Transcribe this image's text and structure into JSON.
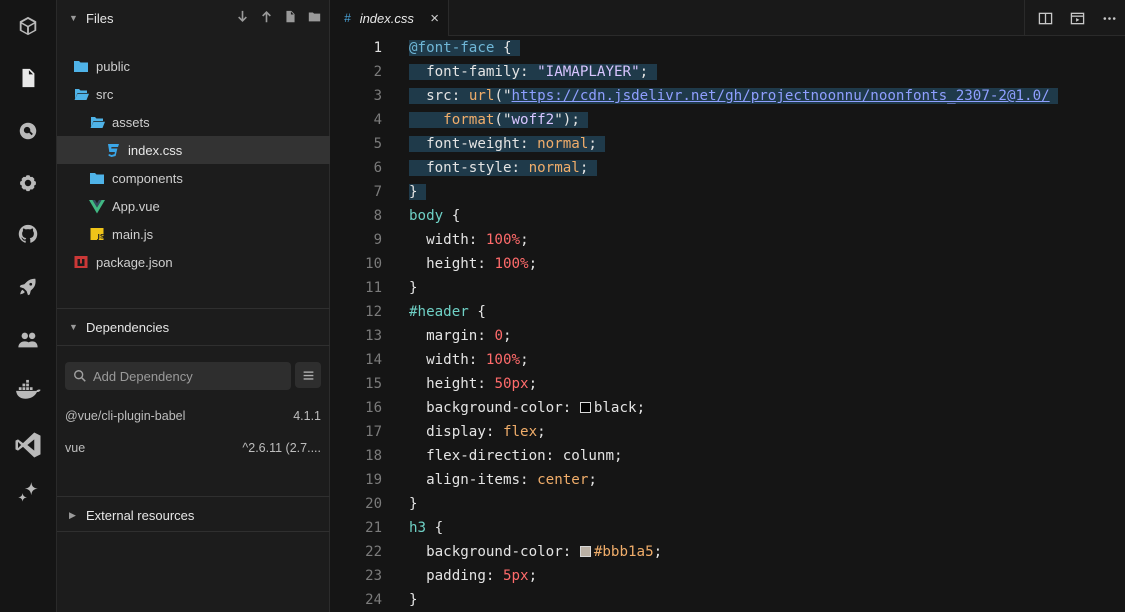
{
  "activity_bar": {
    "icons": [
      "cube-icon",
      "file-icon",
      "search-icon",
      "gear-icon",
      "github-icon",
      "rocket-icon",
      "users-icon",
      "docker-icon",
      "vscode-icon",
      "sparkle-icon"
    ]
  },
  "sidebar": {
    "files_title": "Files",
    "tree": [
      {
        "label": "public",
        "type": "folder"
      },
      {
        "label": "src",
        "type": "folder-open"
      },
      {
        "label": "assets",
        "type": "folder-open"
      },
      {
        "label": "index.css",
        "type": "css"
      },
      {
        "label": "components",
        "type": "folder"
      },
      {
        "label": "App.vue",
        "type": "vue"
      },
      {
        "label": "main.js",
        "type": "js"
      },
      {
        "label": "package.json",
        "type": "npm"
      }
    ],
    "dependencies_title": "Dependencies",
    "dep_search_placeholder": "Add Dependency",
    "dependencies": [
      {
        "name": "@vue/cli-plugin-babel",
        "version": "4.1.1"
      },
      {
        "name": "vue",
        "version": "^2.6.11 (2.7...."
      }
    ],
    "external_title": "External resources"
  },
  "editor": {
    "tab_label": "index.css",
    "tab_close": "×",
    "active_line": 1,
    "lines": [
      {
        "n": "1",
        "segs": [
          [
            "@font-face",
            "t-at"
          ],
          [
            " {",
            "t-punc"
          ]
        ],
        "hl": true
      },
      {
        "n": "2",
        "segs": [
          [
            "  font-family",
            "t-prop"
          ],
          [
            ": ",
            "t-punc"
          ],
          [
            "\"IAMAPLAYER\"",
            "t-str"
          ],
          [
            ";",
            "t-punc"
          ]
        ],
        "hl": true
      },
      {
        "n": "3",
        "segs": [
          [
            "  src",
            "t-prop"
          ],
          [
            ": ",
            "t-punc"
          ],
          [
            "url",
            "t-kw"
          ],
          [
            "(\"",
            "t-punc"
          ],
          [
            "https://cdn.jsdelivr.net/gh/projectnoonnu/noonfonts_2307-2@1.0/",
            "t-url"
          ]
        ],
        "hl": true
      },
      {
        "n": "4",
        "segs": [
          [
            "    format",
            "t-kw"
          ],
          [
            "(\"",
            "t-punc"
          ],
          [
            "woff2",
            "t-str"
          ],
          [
            "\");",
            "t-punc"
          ]
        ],
        "hl": true
      },
      {
        "n": "5",
        "segs": [
          [
            "  font-weight",
            "t-prop"
          ],
          [
            ": ",
            "t-punc"
          ],
          [
            "normal",
            "t-kw"
          ],
          [
            ";",
            "t-punc"
          ]
        ],
        "hl": true
      },
      {
        "n": "6",
        "segs": [
          [
            "  font-style",
            "t-prop"
          ],
          [
            ": ",
            "t-punc"
          ],
          [
            "normal",
            "t-kw"
          ],
          [
            ";",
            "t-punc"
          ]
        ],
        "hl": true
      },
      {
        "n": "7",
        "segs": [
          [
            "}",
            "t-punc"
          ]
        ],
        "hl": true
      },
      {
        "n": "8",
        "segs": [
          [
            "body",
            "t-sel"
          ],
          [
            " {",
            "t-punc"
          ]
        ]
      },
      {
        "n": "9",
        "segs": [
          [
            "  width",
            "t-prop"
          ],
          [
            ": ",
            "t-punc"
          ],
          [
            "100%",
            "t-num"
          ],
          [
            ";",
            "t-punc"
          ]
        ]
      },
      {
        "n": "10",
        "segs": [
          [
            "  height",
            "t-prop"
          ],
          [
            ": ",
            "t-punc"
          ],
          [
            "100%",
            "t-num"
          ],
          [
            ";",
            "t-punc"
          ]
        ]
      },
      {
        "n": "11",
        "segs": [
          [
            "}",
            "t-punc"
          ]
        ]
      },
      {
        "n": "12",
        "segs": [
          [
            "#header",
            "t-id"
          ],
          [
            " {",
            "t-punc"
          ]
        ]
      },
      {
        "n": "13",
        "segs": [
          [
            "  margin",
            "t-prop"
          ],
          [
            ": ",
            "t-punc"
          ],
          [
            "0",
            "t-num"
          ],
          [
            ";",
            "t-punc"
          ]
        ]
      },
      {
        "n": "14",
        "segs": [
          [
            "  width",
            "t-prop"
          ],
          [
            ": ",
            "t-punc"
          ],
          [
            "100%",
            "t-num"
          ],
          [
            ";",
            "t-punc"
          ]
        ]
      },
      {
        "n": "15",
        "segs": [
          [
            "  height",
            "t-prop"
          ],
          [
            ": ",
            "t-punc"
          ],
          [
            "50px",
            "t-num"
          ],
          [
            ";",
            "t-punc"
          ]
        ]
      },
      {
        "n": "16",
        "segs": [
          [
            "  background-color",
            "t-prop"
          ],
          [
            ": ",
            "t-punc"
          ],
          [
            "#000000",
            "swatch"
          ],
          [
            "black",
            "t-prop"
          ],
          [
            ";",
            "t-punc"
          ]
        ]
      },
      {
        "n": "17",
        "segs": [
          [
            "  display",
            "t-prop"
          ],
          [
            ": ",
            "t-punc"
          ],
          [
            "flex",
            "t-kw"
          ],
          [
            ";",
            "t-punc"
          ]
        ]
      },
      {
        "n": "18",
        "segs": [
          [
            "  flex-direction",
            "t-prop"
          ],
          [
            ": ",
            "t-punc"
          ],
          [
            "colunm",
            "t-prop"
          ],
          [
            ";",
            "t-punc"
          ]
        ]
      },
      {
        "n": "19",
        "segs": [
          [
            "  align-items",
            "t-prop"
          ],
          [
            ": ",
            "t-punc"
          ],
          [
            "center",
            "t-kw"
          ],
          [
            ";",
            "t-punc"
          ]
        ]
      },
      {
        "n": "20",
        "segs": [
          [
            "}",
            "t-punc"
          ]
        ]
      },
      {
        "n": "21",
        "segs": [
          [
            "h3",
            "t-sel"
          ],
          [
            " {",
            "t-punc"
          ]
        ]
      },
      {
        "n": "22",
        "segs": [
          [
            "  background-color",
            "t-prop"
          ],
          [
            ": ",
            "t-punc"
          ],
          [
            "#bbb1a5",
            "swatch"
          ],
          [
            "#bbb1a5",
            "t-kw"
          ],
          [
            ";",
            "t-punc"
          ]
        ]
      },
      {
        "n": "23",
        "segs": [
          [
            "  padding",
            "t-prop"
          ],
          [
            ": ",
            "t-punc"
          ],
          [
            "5px",
            "t-num"
          ],
          [
            ";",
            "t-punc"
          ]
        ]
      },
      {
        "n": "24",
        "segs": [
          [
            "}",
            "t-punc"
          ]
        ]
      }
    ]
  },
  "colors": {
    "accent_blue": "#4aa3d8",
    "folder": "#4fb3e8",
    "vue_green": "#41b883",
    "js_yellow": "#f0c419",
    "npm_red": "#cb3837",
    "selection": "#1f3a4a"
  }
}
